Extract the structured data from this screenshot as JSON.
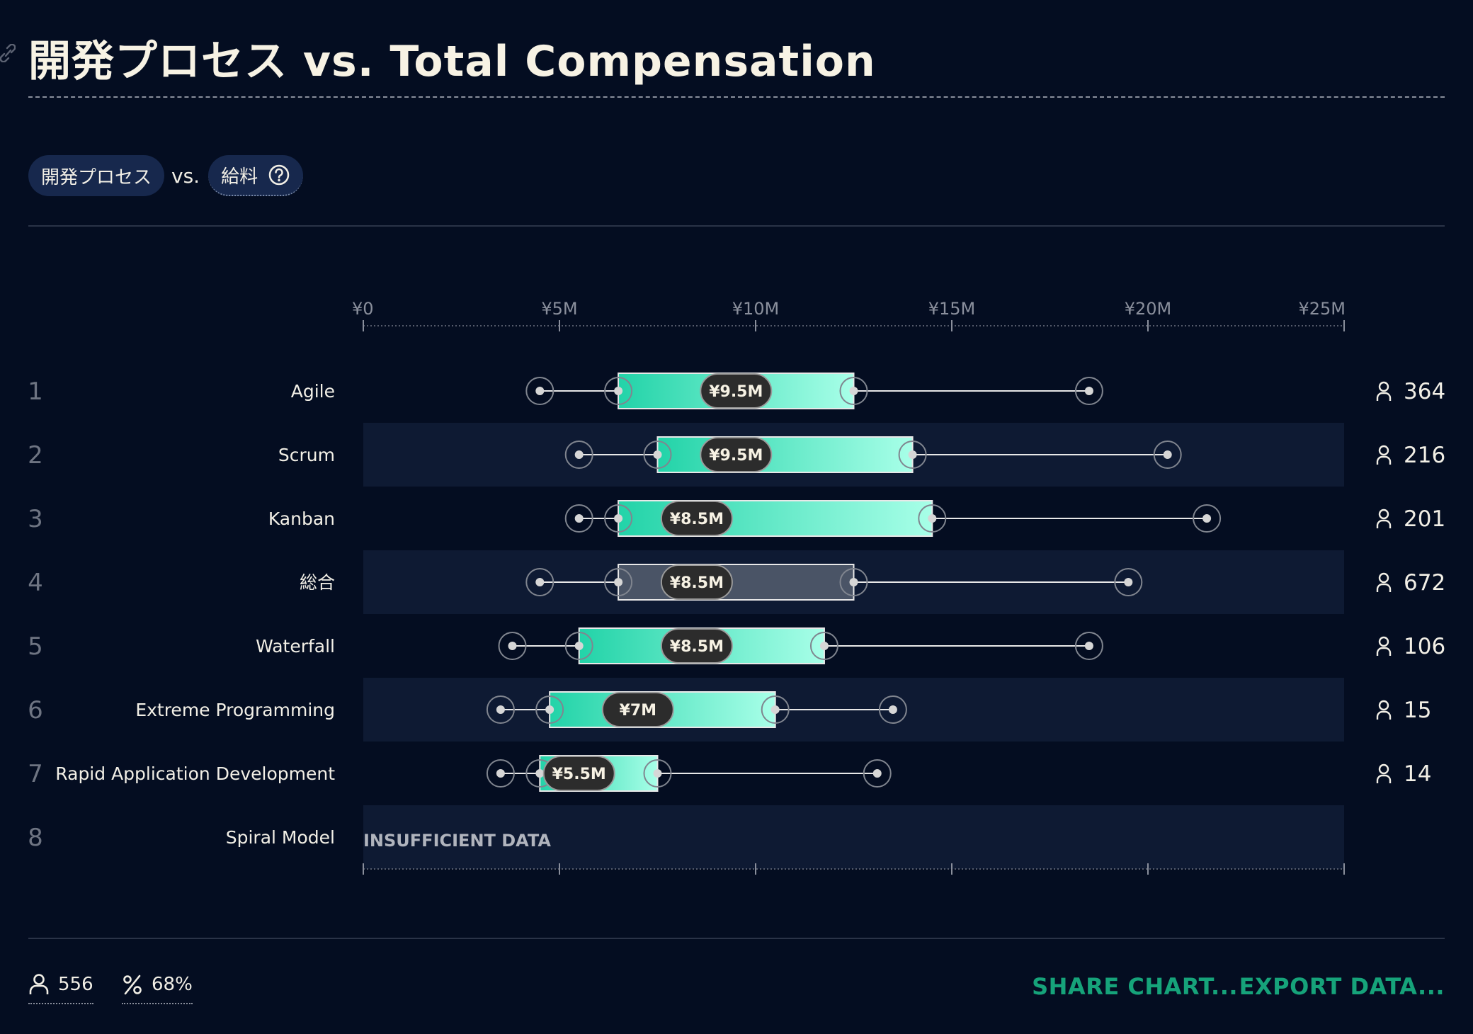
{
  "header": {
    "title": "開発プロセス vs. Total Compensation"
  },
  "filters": {
    "primary_pill": "開発プロセス",
    "vs_label": "vs.",
    "secondary_pill": "給料"
  },
  "chart_data": {
    "type": "boxplot",
    "orientation": "horizontal",
    "xlim": [
      0,
      25
    ],
    "x_unit": "¥M",
    "tick_values": [
      0,
      5,
      10,
      15,
      20,
      25
    ],
    "tick_labels": [
      "¥0",
      "¥5M",
      "¥10M",
      "¥15M",
      "¥20M",
      "¥25M"
    ],
    "rows": [
      {
        "rank": "1",
        "label": "Agile",
        "p10": 4.5,
        "p25": 6.5,
        "median": 9.5,
        "p75": 12.5,
        "p90": 18.5,
        "median_label": "¥9.5M",
        "count": "364",
        "highlight": false
      },
      {
        "rank": "2",
        "label": "Scrum",
        "p10": 5.5,
        "p25": 7.5,
        "median": 9.5,
        "p75": 14.0,
        "p90": 20.5,
        "median_label": "¥9.5M",
        "count": "216",
        "highlight": false
      },
      {
        "rank": "3",
        "label": "Kanban",
        "p10": 5.5,
        "p25": 6.5,
        "median": 8.5,
        "p75": 14.5,
        "p90": 21.5,
        "median_label": "¥8.5M",
        "count": "201",
        "highlight": false
      },
      {
        "rank": "4",
        "label": "総合",
        "p10": 4.5,
        "p25": 6.5,
        "median": 8.5,
        "p75": 12.5,
        "p90": 19.5,
        "median_label": "¥8.5M",
        "count": "672",
        "highlight": true
      },
      {
        "rank": "5",
        "label": "Waterfall",
        "p10": 3.8,
        "p25": 5.5,
        "median": 8.5,
        "p75": 11.75,
        "p90": 18.5,
        "median_label": "¥8.5M",
        "count": "106",
        "highlight": false
      },
      {
        "rank": "6",
        "label": "Extreme Programming",
        "p10": 3.5,
        "p25": 4.75,
        "median": 7.0,
        "p75": 10.5,
        "p90": 13.5,
        "median_label": "¥7M",
        "count": "15",
        "highlight": false
      },
      {
        "rank": "7",
        "label": "Rapid Application Development",
        "p10": 3.5,
        "p25": 4.5,
        "median": 5.5,
        "p75": 7.5,
        "p90": 13.1,
        "median_label": "¥5.5M",
        "count": "14",
        "highlight": false
      },
      {
        "rank": "8",
        "label": "Spiral Model",
        "insufficient_label": "INSUFFICIENT DATA",
        "highlight": false
      }
    ],
    "colors": {
      "box_start": "#22d3a8",
      "box_end": "#a8ffe8",
      "overall_box": "#4a5466",
      "stripe": "#0e1a33",
      "median_pill": "#2c2c2c"
    }
  },
  "footer": {
    "respondents": "556",
    "percent": "68%",
    "share_label": "SHARE CHART...",
    "export_label": "EXPORT DATA..."
  }
}
